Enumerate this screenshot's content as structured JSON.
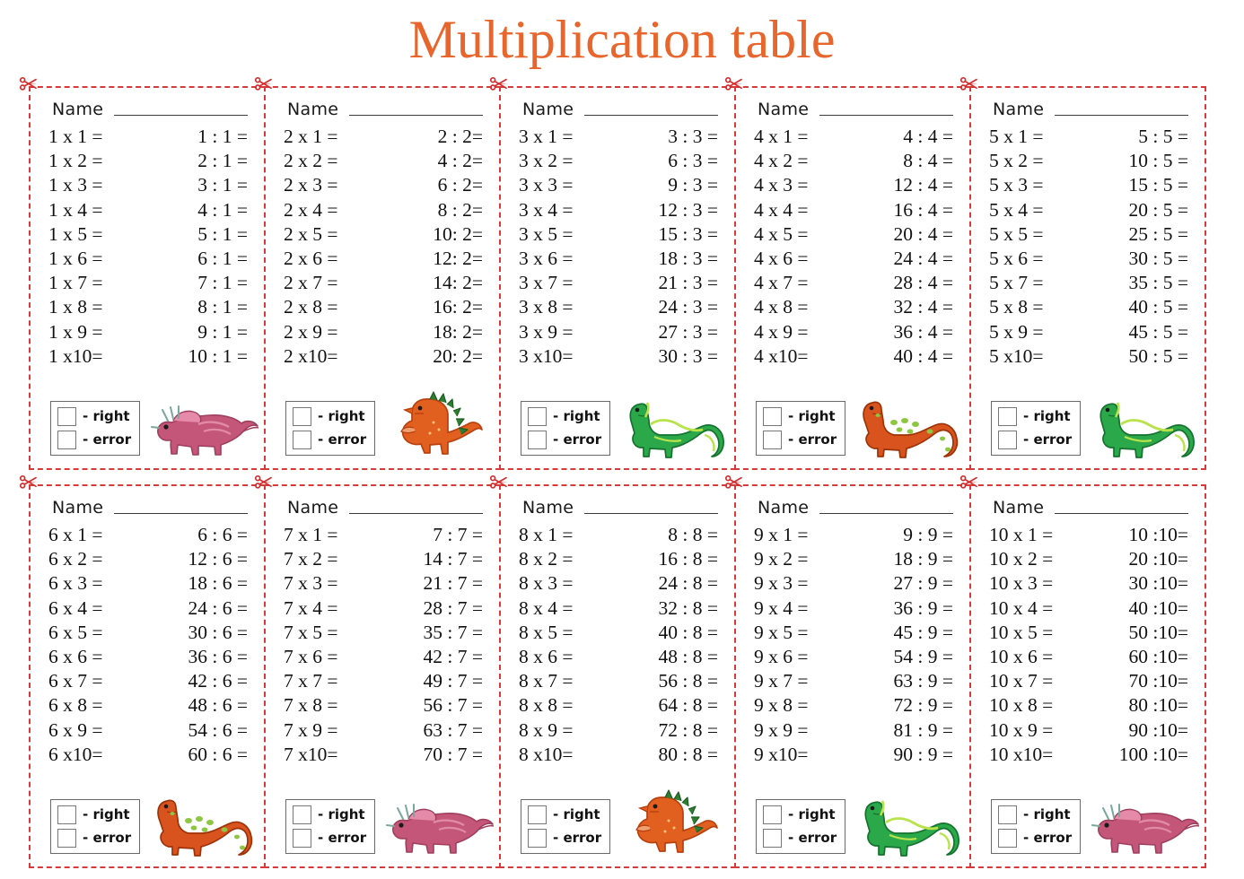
{
  "title": "Multiplication table",
  "colors": {
    "title": "#e8652b",
    "cut_border": "#d83a3a",
    "scissors": "#d32f2f",
    "text": "#111111",
    "dino_pink": "#c4567a",
    "dino_pink_dark": "#a8days",
    "dino_orange": "#e2601f",
    "dino_green": "#2aa84a"
  },
  "labels": {
    "name": "Name",
    "right": "- right",
    "error": "- error"
  },
  "cards": [
    {
      "table": 1,
      "dino": "triceratops-pink",
      "rows": [
        {
          "mul": "1 x 1 =",
          "div": "1 : 1 ="
        },
        {
          "mul": "1 x 2 =",
          "div": "2 : 1 ="
        },
        {
          "mul": "1 x 3 =",
          "div": "3 : 1 ="
        },
        {
          "mul": "1 x 4 =",
          "div": "4 : 1 ="
        },
        {
          "mul": "1 x 5 =",
          "div": "5 : 1 ="
        },
        {
          "mul": "1 x 6 =",
          "div": "6 : 1 ="
        },
        {
          "mul": "1 x 7 =",
          "div": "7 : 1 ="
        },
        {
          "mul": "1 x 8 =",
          "div": "8 : 1 ="
        },
        {
          "mul": "1 x 9 =",
          "div": "9 : 1 ="
        },
        {
          "mul": "1 x10=",
          "div": "10 : 1 ="
        }
      ]
    },
    {
      "table": 2,
      "dino": "trex-orange",
      "rows": [
        {
          "mul": "2 x 1 =",
          "div": "2 : 2="
        },
        {
          "mul": "2 x 2 =",
          "div": "4 : 2="
        },
        {
          "mul": "2 x 3 =",
          "div": "6 : 2="
        },
        {
          "mul": "2 x 4 =",
          "div": "8 : 2="
        },
        {
          "mul": "2 x 5 =",
          "div": "10: 2="
        },
        {
          "mul": "2 x 6 =",
          "div": "12: 2="
        },
        {
          "mul": "2 x 7 =",
          "div": "14: 2="
        },
        {
          "mul": "2 x 8 =",
          "div": "16: 2="
        },
        {
          "mul": "2 x 9 =",
          "div": "18: 2="
        },
        {
          "mul": "2 x10=",
          "div": "20: 2="
        }
      ]
    },
    {
      "table": 3,
      "dino": "brontosaurus-green",
      "rows": [
        {
          "mul": "3 x 1 =",
          "div": "3 : 3 ="
        },
        {
          "mul": "3 x 2 =",
          "div": "6 : 3 ="
        },
        {
          "mul": "3 x 3 =",
          "div": "9 : 3 ="
        },
        {
          "mul": "3 x 4 =",
          "div": "12 : 3 ="
        },
        {
          "mul": "3 x 5 =",
          "div": "15 : 3 ="
        },
        {
          "mul": "3 x 6 =",
          "div": "18 : 3 ="
        },
        {
          "mul": "3 x 7 =",
          "div": "21 : 3 ="
        },
        {
          "mul": "3 x 8 =",
          "div": "24 : 3 ="
        },
        {
          "mul": "3 x 9 =",
          "div": "27 : 3 ="
        },
        {
          "mul": "3 x10=",
          "div": "30 : 3 ="
        }
      ]
    },
    {
      "table": 4,
      "dino": "brontosaurus-orange",
      "rows": [
        {
          "mul": "4 x 1 =",
          "div": "4 : 4 ="
        },
        {
          "mul": "4 x 2 =",
          "div": "8 : 4 ="
        },
        {
          "mul": "4 x 3 =",
          "div": "12 : 4 ="
        },
        {
          "mul": "4 x 4 =",
          "div": "16 : 4 ="
        },
        {
          "mul": "4 x 5 =",
          "div": "20 : 4 ="
        },
        {
          "mul": "4 x 6 =",
          "div": "24 : 4 ="
        },
        {
          "mul": "4 x 7 =",
          "div": "28 : 4 ="
        },
        {
          "mul": "4 x 8 =",
          "div": "32 : 4 ="
        },
        {
          "mul": "4 x 9 =",
          "div": "36 : 4 ="
        },
        {
          "mul": "4 x10=",
          "div": "40 : 4 ="
        }
      ]
    },
    {
      "table": 5,
      "dino": "brontosaurus-green",
      "rows": [
        {
          "mul": "5 x 1 =",
          "div": "5 : 5 ="
        },
        {
          "mul": "5 x 2 =",
          "div": "10 : 5 ="
        },
        {
          "mul": "5 x 3 =",
          "div": "15 : 5 ="
        },
        {
          "mul": "5 x 4 =",
          "div": "20 : 5 ="
        },
        {
          "mul": "5 x 5 =",
          "div": "25 : 5 ="
        },
        {
          "mul": "5 x 6 =",
          "div": "30 : 5 ="
        },
        {
          "mul": "5 x 7 =",
          "div": "35 : 5 ="
        },
        {
          "mul": "5 x 8 =",
          "div": "40 : 5 ="
        },
        {
          "mul": "5 x 9 =",
          "div": "45 : 5 ="
        },
        {
          "mul": "5 x10=",
          "div": "50 : 5 ="
        }
      ]
    },
    {
      "table": 6,
      "dino": "brontosaurus-orange",
      "rows": [
        {
          "mul": "6 x 1 =",
          "div": "6 : 6 ="
        },
        {
          "mul": "6 x 2 =",
          "div": "12 : 6 ="
        },
        {
          "mul": "6 x 3 =",
          "div": "18 : 6 ="
        },
        {
          "mul": "6 x 4 =",
          "div": "24 : 6 ="
        },
        {
          "mul": "6 x 5 =",
          "div": "30 : 6 ="
        },
        {
          "mul": "6 x 6 =",
          "div": "36 : 6 ="
        },
        {
          "mul": "6 x 7 =",
          "div": "42 : 6 ="
        },
        {
          "mul": "6 x 8 =",
          "div": "48 : 6 ="
        },
        {
          "mul": "6 x 9 =",
          "div": "54 : 6 ="
        },
        {
          "mul": "6 x10=",
          "div": "60 : 6 ="
        }
      ]
    },
    {
      "table": 7,
      "dino": "triceratops-pink",
      "rows": [
        {
          "mul": "7 x 1 =",
          "div": "7 : 7 ="
        },
        {
          "mul": "7 x 2 =",
          "div": "14 : 7 ="
        },
        {
          "mul": "7 x 3 =",
          "div": "21 : 7 ="
        },
        {
          "mul": "7 x 4 =",
          "div": "28 : 7 ="
        },
        {
          "mul": "7 x 5 =",
          "div": "35 : 7 ="
        },
        {
          "mul": "7 x 6 =",
          "div": "42 : 7 ="
        },
        {
          "mul": "7 x 7 =",
          "div": "49 : 7 ="
        },
        {
          "mul": "7 x 8 =",
          "div": "56 : 7 ="
        },
        {
          "mul": "7 x 9 =",
          "div": "63 : 7 ="
        },
        {
          "mul": "7 x10=",
          "div": "70 : 7 ="
        }
      ]
    },
    {
      "table": 8,
      "dino": "trex-orange",
      "rows": [
        {
          "mul": "8 x 1 =",
          "div": "8 : 8 ="
        },
        {
          "mul": "8 x 2 =",
          "div": "16 : 8 ="
        },
        {
          "mul": "8 x 3 =",
          "div": "24 : 8 ="
        },
        {
          "mul": "8 x 4 =",
          "div": "32 : 8 ="
        },
        {
          "mul": "8 x 5 =",
          "div": "40 : 8 ="
        },
        {
          "mul": "8 x 6 =",
          "div": "48 : 8 ="
        },
        {
          "mul": "8 x 7 =",
          "div": "56 : 8 ="
        },
        {
          "mul": "8 x 8 =",
          "div": "64 : 8 ="
        },
        {
          "mul": "8 x 9 =",
          "div": "72 : 8 ="
        },
        {
          "mul": "8 x10=",
          "div": "80 : 8 ="
        }
      ]
    },
    {
      "table": 9,
      "dino": "brontosaurus-green",
      "rows": [
        {
          "mul": "9 x 1 =",
          "div": "9 : 9 ="
        },
        {
          "mul": "9 x 2 =",
          "div": "18 : 9 ="
        },
        {
          "mul": "9 x 3 =",
          "div": "27 : 9 ="
        },
        {
          "mul": "9 x 4 =",
          "div": "36 : 9 ="
        },
        {
          "mul": "9 x 5 =",
          "div": "45 : 9 ="
        },
        {
          "mul": "9 x 6 =",
          "div": "54 : 9 ="
        },
        {
          "mul": "9 x 7 =",
          "div": "63 : 9 ="
        },
        {
          "mul": "9 x 8 =",
          "div": "72 : 9 ="
        },
        {
          "mul": "9 x 9 =",
          "div": "81 : 9 ="
        },
        {
          "mul": "9 x10=",
          "div": "90 : 9 ="
        }
      ]
    },
    {
      "table": 10,
      "dino": "triceratops-pink",
      "rows": [
        {
          "mul": "10 x 1 =",
          "div": "10 :10="
        },
        {
          "mul": "10 x 2 =",
          "div": "20 :10="
        },
        {
          "mul": "10 x 3 =",
          "div": "30 :10="
        },
        {
          "mul": "10 x 4 =",
          "div": "40 :10="
        },
        {
          "mul": "10 x 5 =",
          "div": "50 :10="
        },
        {
          "mul": "10 x 6 =",
          "div": "60 :10="
        },
        {
          "mul": "10 x 7 =",
          "div": "70 :10="
        },
        {
          "mul": "10 x 8 =",
          "div": "80 :10="
        },
        {
          "mul": "10 x 9 =",
          "div": "90 :10="
        },
        {
          "mul": "10 x10=",
          "div": "100 :10="
        }
      ]
    }
  ]
}
